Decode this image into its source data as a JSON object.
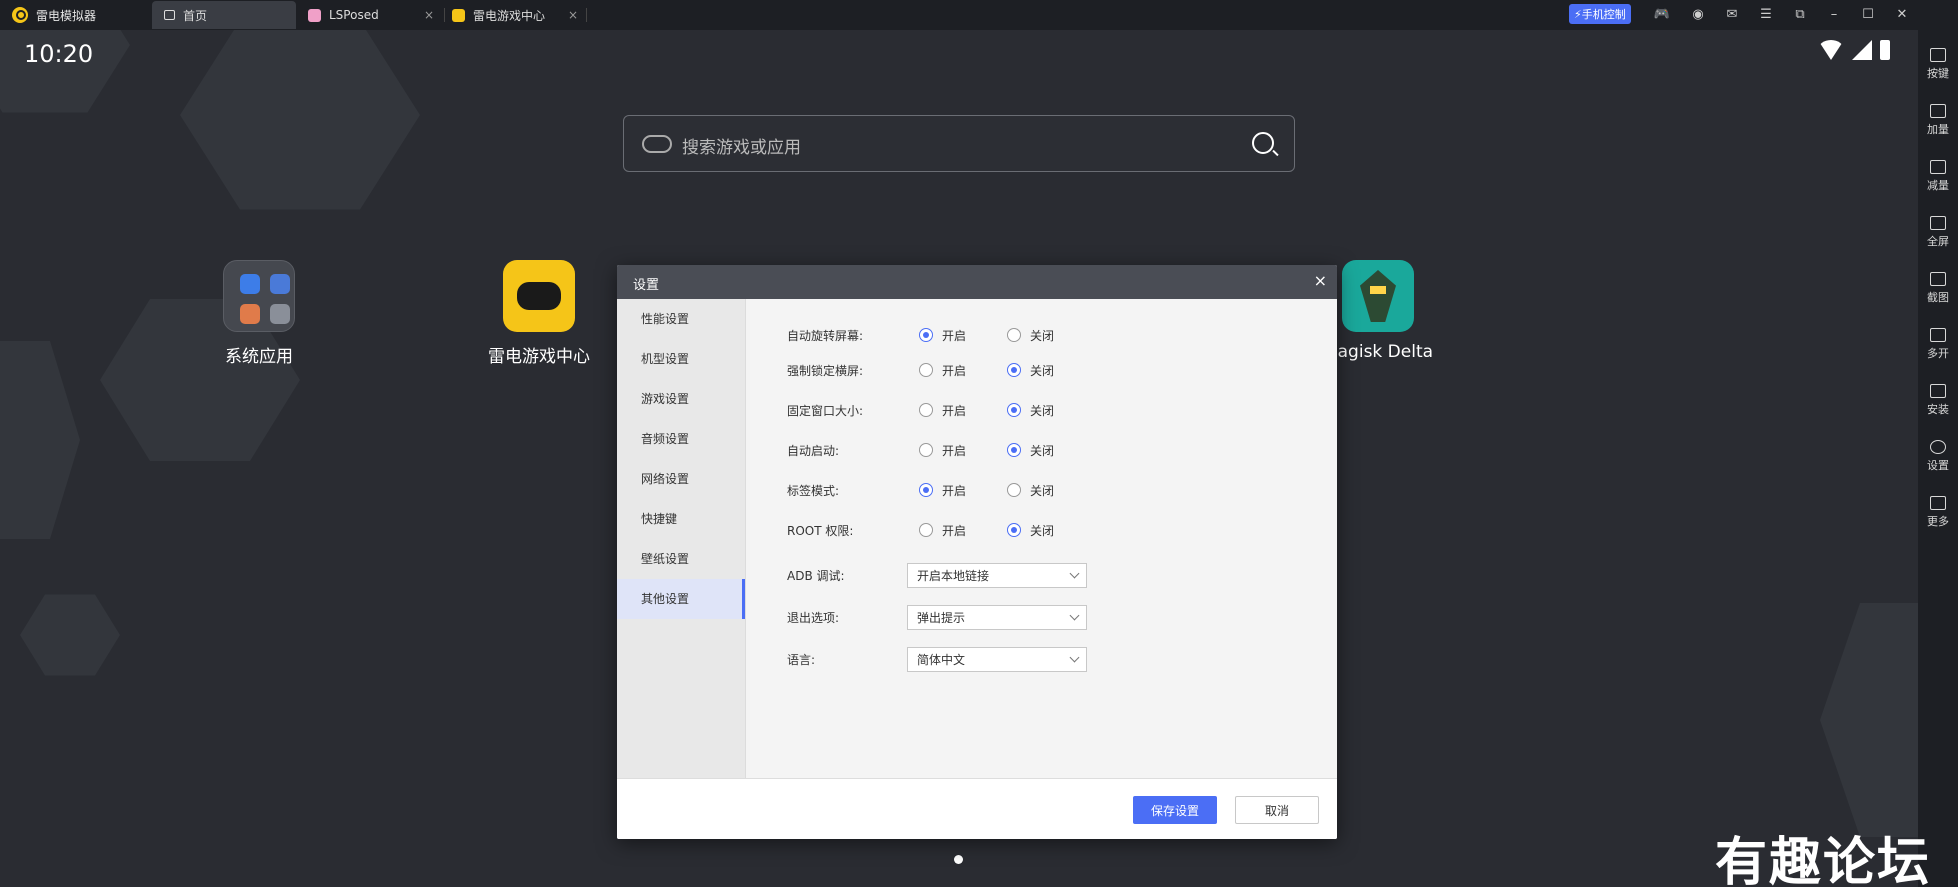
{
  "titlebar": {
    "app_name": "雷电模拟器",
    "tabs": [
      {
        "label": "首页",
        "icon": "home-icon"
      },
      {
        "label": "LSPosed",
        "icon": "lsposed-icon"
      },
      {
        "label": "雷电游戏中心",
        "icon": "leidian-gamecenter-icon"
      }
    ],
    "phone_control_label": "手机控制",
    "close_glyph": "×"
  },
  "statusbar": {
    "time": "10:20"
  },
  "search": {
    "placeholder": "搜索游戏或应用"
  },
  "apps": [
    {
      "label": "系统应用"
    },
    {
      "label": "雷电游戏中心"
    },
    {
      "label": "Magisk Delta"
    }
  ],
  "rightbar": {
    "items": [
      {
        "label": "按键",
        "icon": "keyboard-icon"
      },
      {
        "label": "加量",
        "icon": "volume-up-icon"
      },
      {
        "label": "减量",
        "icon": "volume-down-icon"
      },
      {
        "label": "全屏",
        "icon": "fullscreen-icon"
      },
      {
        "label": "截图",
        "icon": "scissors-icon"
      },
      {
        "label": "多开",
        "icon": "multi-instance-icon"
      },
      {
        "label": "安装",
        "icon": "apk-install-icon"
      },
      {
        "label": "设置",
        "icon": "settings-icon"
      },
      {
        "label": "更多",
        "icon": "more-icon"
      }
    ]
  },
  "dialog": {
    "title": "设置",
    "nav": [
      "性能设置",
      "机型设置",
      "游戏设置",
      "音频设置",
      "网络设置",
      "快捷键",
      "壁纸设置",
      "其他设置"
    ],
    "active_nav": "其他设置",
    "on_label": "开启",
    "off_label": "关闭",
    "options": [
      {
        "label": "自动旋转屏幕:",
        "value": "开启"
      },
      {
        "label": "强制锁定横屏:",
        "value": "关闭"
      },
      {
        "label": "固定窗口大小:",
        "value": "关闭"
      },
      {
        "label": "自动启动:",
        "value": "关闭"
      },
      {
        "label": "标签模式:",
        "value": "开启"
      },
      {
        "label": "ROOT 权限:",
        "value": "关闭"
      }
    ],
    "selects": [
      {
        "label": "ADB 调试:",
        "value": "开启本地链接"
      },
      {
        "label": "退出选项:",
        "value": "弹出提示"
      },
      {
        "label": "语言:",
        "value": "简体中文"
      }
    ],
    "save_label": "保存设置",
    "cancel_label": "取消"
  },
  "watermark": "有趣论坛",
  "colors": {
    "accent": "#4b6ef5",
    "dialog_header": "#4a4d55",
    "background": "#2a2c32"
  }
}
